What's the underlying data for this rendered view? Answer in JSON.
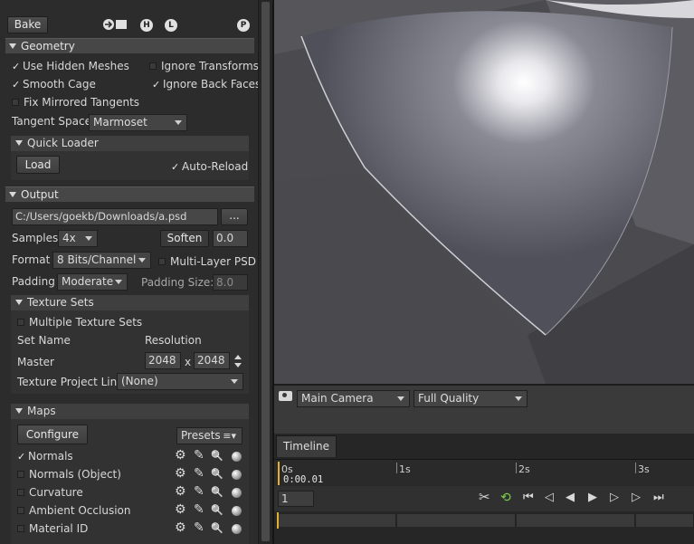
{
  "toolbar": {
    "bake_label": "Bake",
    "circle_h": "H",
    "circle_l": "L",
    "circle_p": "P"
  },
  "geometry": {
    "header": "Geometry",
    "use_hidden_meshes": "Use Hidden Meshes",
    "ignore_transforms": "Ignore Transforms",
    "smooth_cage": "Smooth Cage",
    "ignore_back_faces": "Ignore Back Faces",
    "fix_mirrored_tangents": "Fix Mirrored Tangents",
    "tangent_space_label": "Tangent Space",
    "tangent_space_value": "Marmoset",
    "quick_loader_header": "Quick Loader",
    "load_label": "Load",
    "auto_reload": "Auto-Reload"
  },
  "output": {
    "header": "Output",
    "path": "C:/Users/goekb/Downloads/a.psd",
    "browse_label": "...",
    "samples_label": "Samples",
    "samples_value": "4x",
    "soften_label": "Soften",
    "soften_value": "0.0",
    "format_label": "Format",
    "format_value": "8 Bits/Channel",
    "multilayer_psd": "Multi-Layer PSD",
    "padding_label": "Padding",
    "padding_value": "Moderate",
    "padding_size_label": "Padding Size:",
    "padding_size_value": "8.0"
  },
  "texture_sets": {
    "header": "Texture Sets",
    "multiple_texture_sets": "Multiple Texture Sets",
    "col_set_name": "Set Name",
    "col_resolution": "Resolution",
    "row_name": "Master",
    "res_w": "2048",
    "res_x": "x",
    "res_h": "2048",
    "project_link_label": "Texture Project Link",
    "project_link_value": "(None)"
  },
  "maps": {
    "header": "Maps",
    "configure_label": "Configure",
    "presets_label": "Presets",
    "items": [
      {
        "label": "Normals",
        "checked": true
      },
      {
        "label": "Normals (Object)",
        "checked": false
      },
      {
        "label": "Curvature",
        "checked": false
      },
      {
        "label": "Ambient Occlusion",
        "checked": false
      },
      {
        "label": "Material ID",
        "checked": false
      }
    ]
  },
  "camera": {
    "camera_value": "Main Camera",
    "quality_value": "Full Quality"
  },
  "timeline": {
    "tab_label": "Timeline",
    "tick_0": "0s",
    "tick_1": "1s",
    "tick_2": "2s",
    "tick_3": "3s",
    "current_time": "0:00.01",
    "frame_value": "1"
  },
  "icons": {
    "tick": "✓",
    "gear": "⚙",
    "pencil": "✎",
    "search": "🔍",
    "scissors": "✂",
    "loop": "⟲",
    "first": "⏮",
    "prev_key": "◁",
    "prev_frame": "◀",
    "play": "▶",
    "next_frame": "▷",
    "next_key": "▷",
    "last": "⏭"
  },
  "colors": {
    "accent_loop": "#7fd04a",
    "playhead": "#e0b030"
  }
}
